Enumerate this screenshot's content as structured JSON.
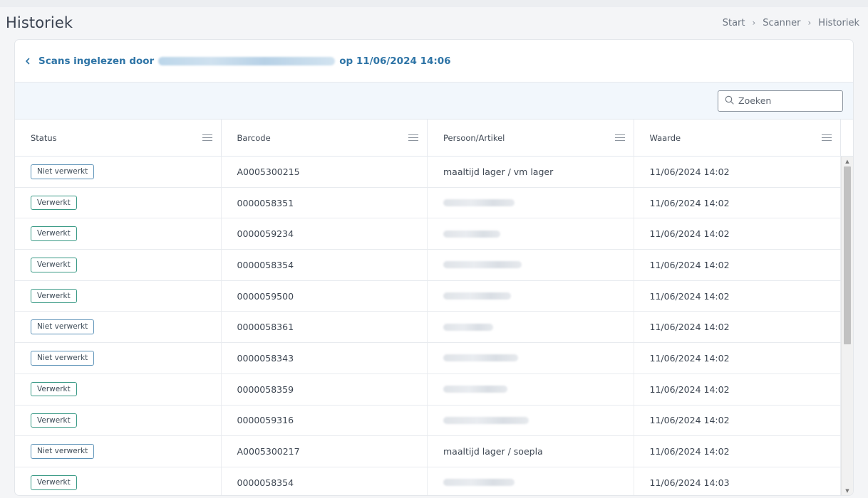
{
  "page": {
    "title": "Historiek",
    "breadcrumb": [
      "Start",
      "Scanner",
      "Historiek"
    ]
  },
  "card": {
    "heading_prefix": "Scans ingelezen door",
    "heading_suffix": "op 11/06/2024 14:06"
  },
  "search": {
    "placeholder": "Zoeken"
  },
  "table": {
    "columns": [
      "Status",
      "Barcode",
      "Persoon/Artikel",
      "Waarde"
    ],
    "rows": [
      {
        "status": "Niet verwerkt",
        "barcode": "A0005300215",
        "person": "maaltijd lager / vm lager",
        "value": "11/06/2024 14:02"
      },
      {
        "status": "Verwerkt",
        "barcode": "0000058351",
        "person": "",
        "value": "11/06/2024 14:02"
      },
      {
        "status": "Verwerkt",
        "barcode": "0000059234",
        "person": "",
        "value": "11/06/2024 14:02"
      },
      {
        "status": "Verwerkt",
        "barcode": "0000058354",
        "person": "",
        "value": "11/06/2024 14:02"
      },
      {
        "status": "Verwerkt",
        "barcode": "0000059500",
        "person": "",
        "value": "11/06/2024 14:02"
      },
      {
        "status": "Niet verwerkt",
        "barcode": "0000058361",
        "person": "",
        "value": "11/06/2024 14:02"
      },
      {
        "status": "Niet verwerkt",
        "barcode": "0000058343",
        "person": "",
        "value": "11/06/2024 14:02"
      },
      {
        "status": "Verwerkt",
        "barcode": "0000058359",
        "person": "",
        "value": "11/06/2024 14:02"
      },
      {
        "status": "Verwerkt",
        "barcode": "0000059316",
        "person": "",
        "value": "11/06/2024 14:02"
      },
      {
        "status": "Niet verwerkt",
        "barcode": "A0005300217",
        "person": "maaltijd lager / soepla",
        "value": "11/06/2024 14:02"
      },
      {
        "status": "Verwerkt",
        "barcode": "0000058354",
        "person": "",
        "value": "11/06/2024 14:03"
      }
    ]
  },
  "colors": {
    "accent": "#2e74a6",
    "badge_verwerkt": "#3a9a86",
    "badge_niet_verwerkt": "#5e93b8"
  },
  "icons": {
    "back": "chevron-left-icon",
    "search": "search-icon",
    "column_menu": "menu-icon"
  }
}
